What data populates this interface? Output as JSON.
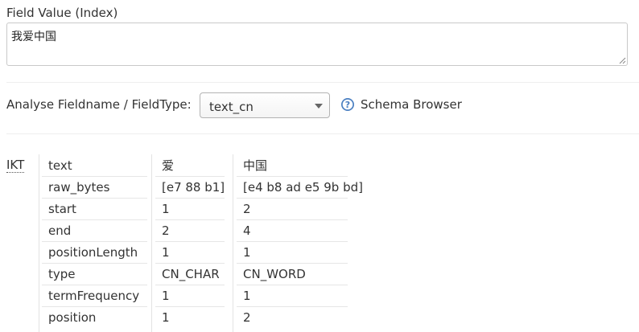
{
  "field_value": {
    "label": "Field Value (Index)",
    "value": "我爱中国"
  },
  "analyse": {
    "label": "Analyse Fieldname / FieldType:",
    "selected": "text_cn",
    "schema_browser_label": "Schema Browser"
  },
  "analysis": {
    "analyzer": "IKT",
    "rows": [
      {
        "attr": "text",
        "tokens": [
          "爱",
          "中国"
        ]
      },
      {
        "attr": "raw_bytes",
        "tokens": [
          "[e7 88 b1]",
          "[e4 b8 ad e5 9b bd]"
        ]
      },
      {
        "attr": "start",
        "tokens": [
          "1",
          "2"
        ]
      },
      {
        "attr": "end",
        "tokens": [
          "2",
          "4"
        ]
      },
      {
        "attr": "positionLength",
        "tokens": [
          "1",
          "1"
        ]
      },
      {
        "attr": "type",
        "tokens": [
          "CN_CHAR",
          "CN_WORD"
        ]
      },
      {
        "attr": "termFrequency",
        "tokens": [
          "1",
          "1"
        ]
      },
      {
        "attr": "position",
        "tokens": [
          "1",
          "2"
        ]
      }
    ]
  },
  "colors": {
    "help_icon": "#4a7fc1"
  }
}
